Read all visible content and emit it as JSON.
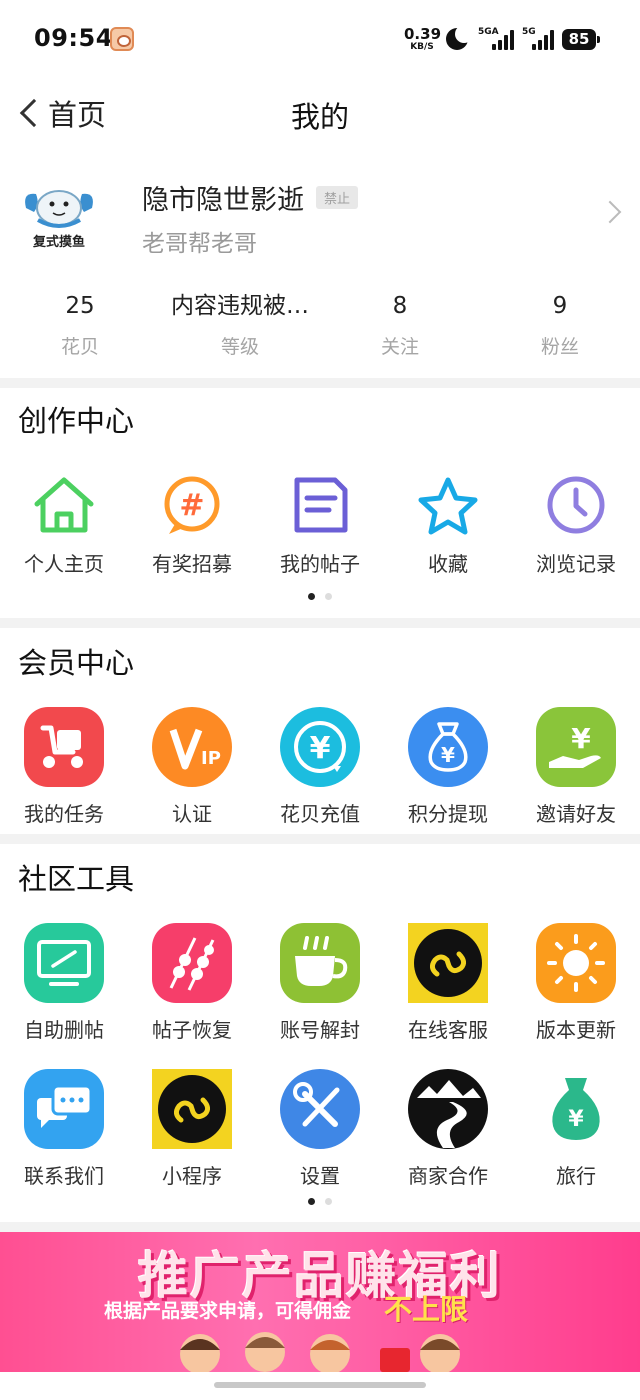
{
  "status_bar": {
    "time": "09:54",
    "net_speed": "0.39",
    "net_speed_unit": "KB/S",
    "sim1_label": "5GA",
    "sim2_label": "5G",
    "battery": "85"
  },
  "header": {
    "back_label": "首页",
    "title": "我的"
  },
  "profile": {
    "avatar_caption": "复式摸鱼",
    "username": "隐市隐世影逝",
    "badge": "禁止",
    "signature": "老哥帮老哥"
  },
  "stats": [
    {
      "value": "25",
      "label": "花贝"
    },
    {
      "value": "内容违规被…",
      "label": "等级"
    },
    {
      "value": "8",
      "label": "关注"
    },
    {
      "value": "9",
      "label": "粉丝"
    }
  ],
  "creation_center": {
    "title": "创作中心",
    "items": [
      {
        "label": "个人主页",
        "icon": "home-icon"
      },
      {
        "label": "有奖招募",
        "icon": "hashtag-icon"
      },
      {
        "label": "我的帖子",
        "icon": "document-icon"
      },
      {
        "label": "收藏",
        "icon": "star-icon"
      },
      {
        "label": "浏览记录",
        "icon": "clock-icon"
      }
    ]
  },
  "member_center": {
    "title": "会员中心",
    "items": [
      {
        "label": "我的任务",
        "icon": "scooter-icon",
        "color": "#f2494d"
      },
      {
        "label": "认证",
        "icon": "vip-icon",
        "color": "#fd8a24"
      },
      {
        "label": "花贝充值",
        "icon": "yen-recharge-icon",
        "color": "#1cbddf"
      },
      {
        "label": "积分提现",
        "icon": "money-bag-icon",
        "color": "#3b8ef0"
      },
      {
        "label": "邀请好友",
        "icon": "hand-yen-icon",
        "color": "#8ac53a"
      }
    ]
  },
  "community_tools": {
    "title": "社区工具",
    "row1": [
      {
        "label": "自助删帖",
        "icon": "monitor-edit-icon",
        "color": "#27c99b"
      },
      {
        "label": "帖子恢复",
        "icon": "skewer-icon",
        "color": "#f63e6a"
      },
      {
        "label": "账号解封",
        "icon": "coffee-cup-icon",
        "color": "#8ec134"
      },
      {
        "label": "在线客服",
        "icon": "mini-program-icon",
        "color": "#f3d320"
      },
      {
        "label": "版本更新",
        "icon": "sun-icon",
        "color": "#fb9c1c"
      }
    ],
    "row2": [
      {
        "label": "联系我们",
        "icon": "chat-bubbles-icon",
        "color": "#33a3f0"
      },
      {
        "label": "小程序",
        "icon": "mini-program-icon",
        "color": "#f3d320"
      },
      {
        "label": "设置",
        "icon": "wrench-screwdriver-icon",
        "color": "#3f87e6"
      },
      {
        "label": "商家合作",
        "icon": "mountain-road-icon",
        "color": "#111111"
      },
      {
        "label": "旅行",
        "icon": "yen-bag-icon",
        "color": "#2bb88b"
      }
    ]
  },
  "banner": {
    "title": "推广产品赚福利",
    "subtitle": "根据产品要求申请，可得佣金",
    "highlight": "不上限"
  }
}
